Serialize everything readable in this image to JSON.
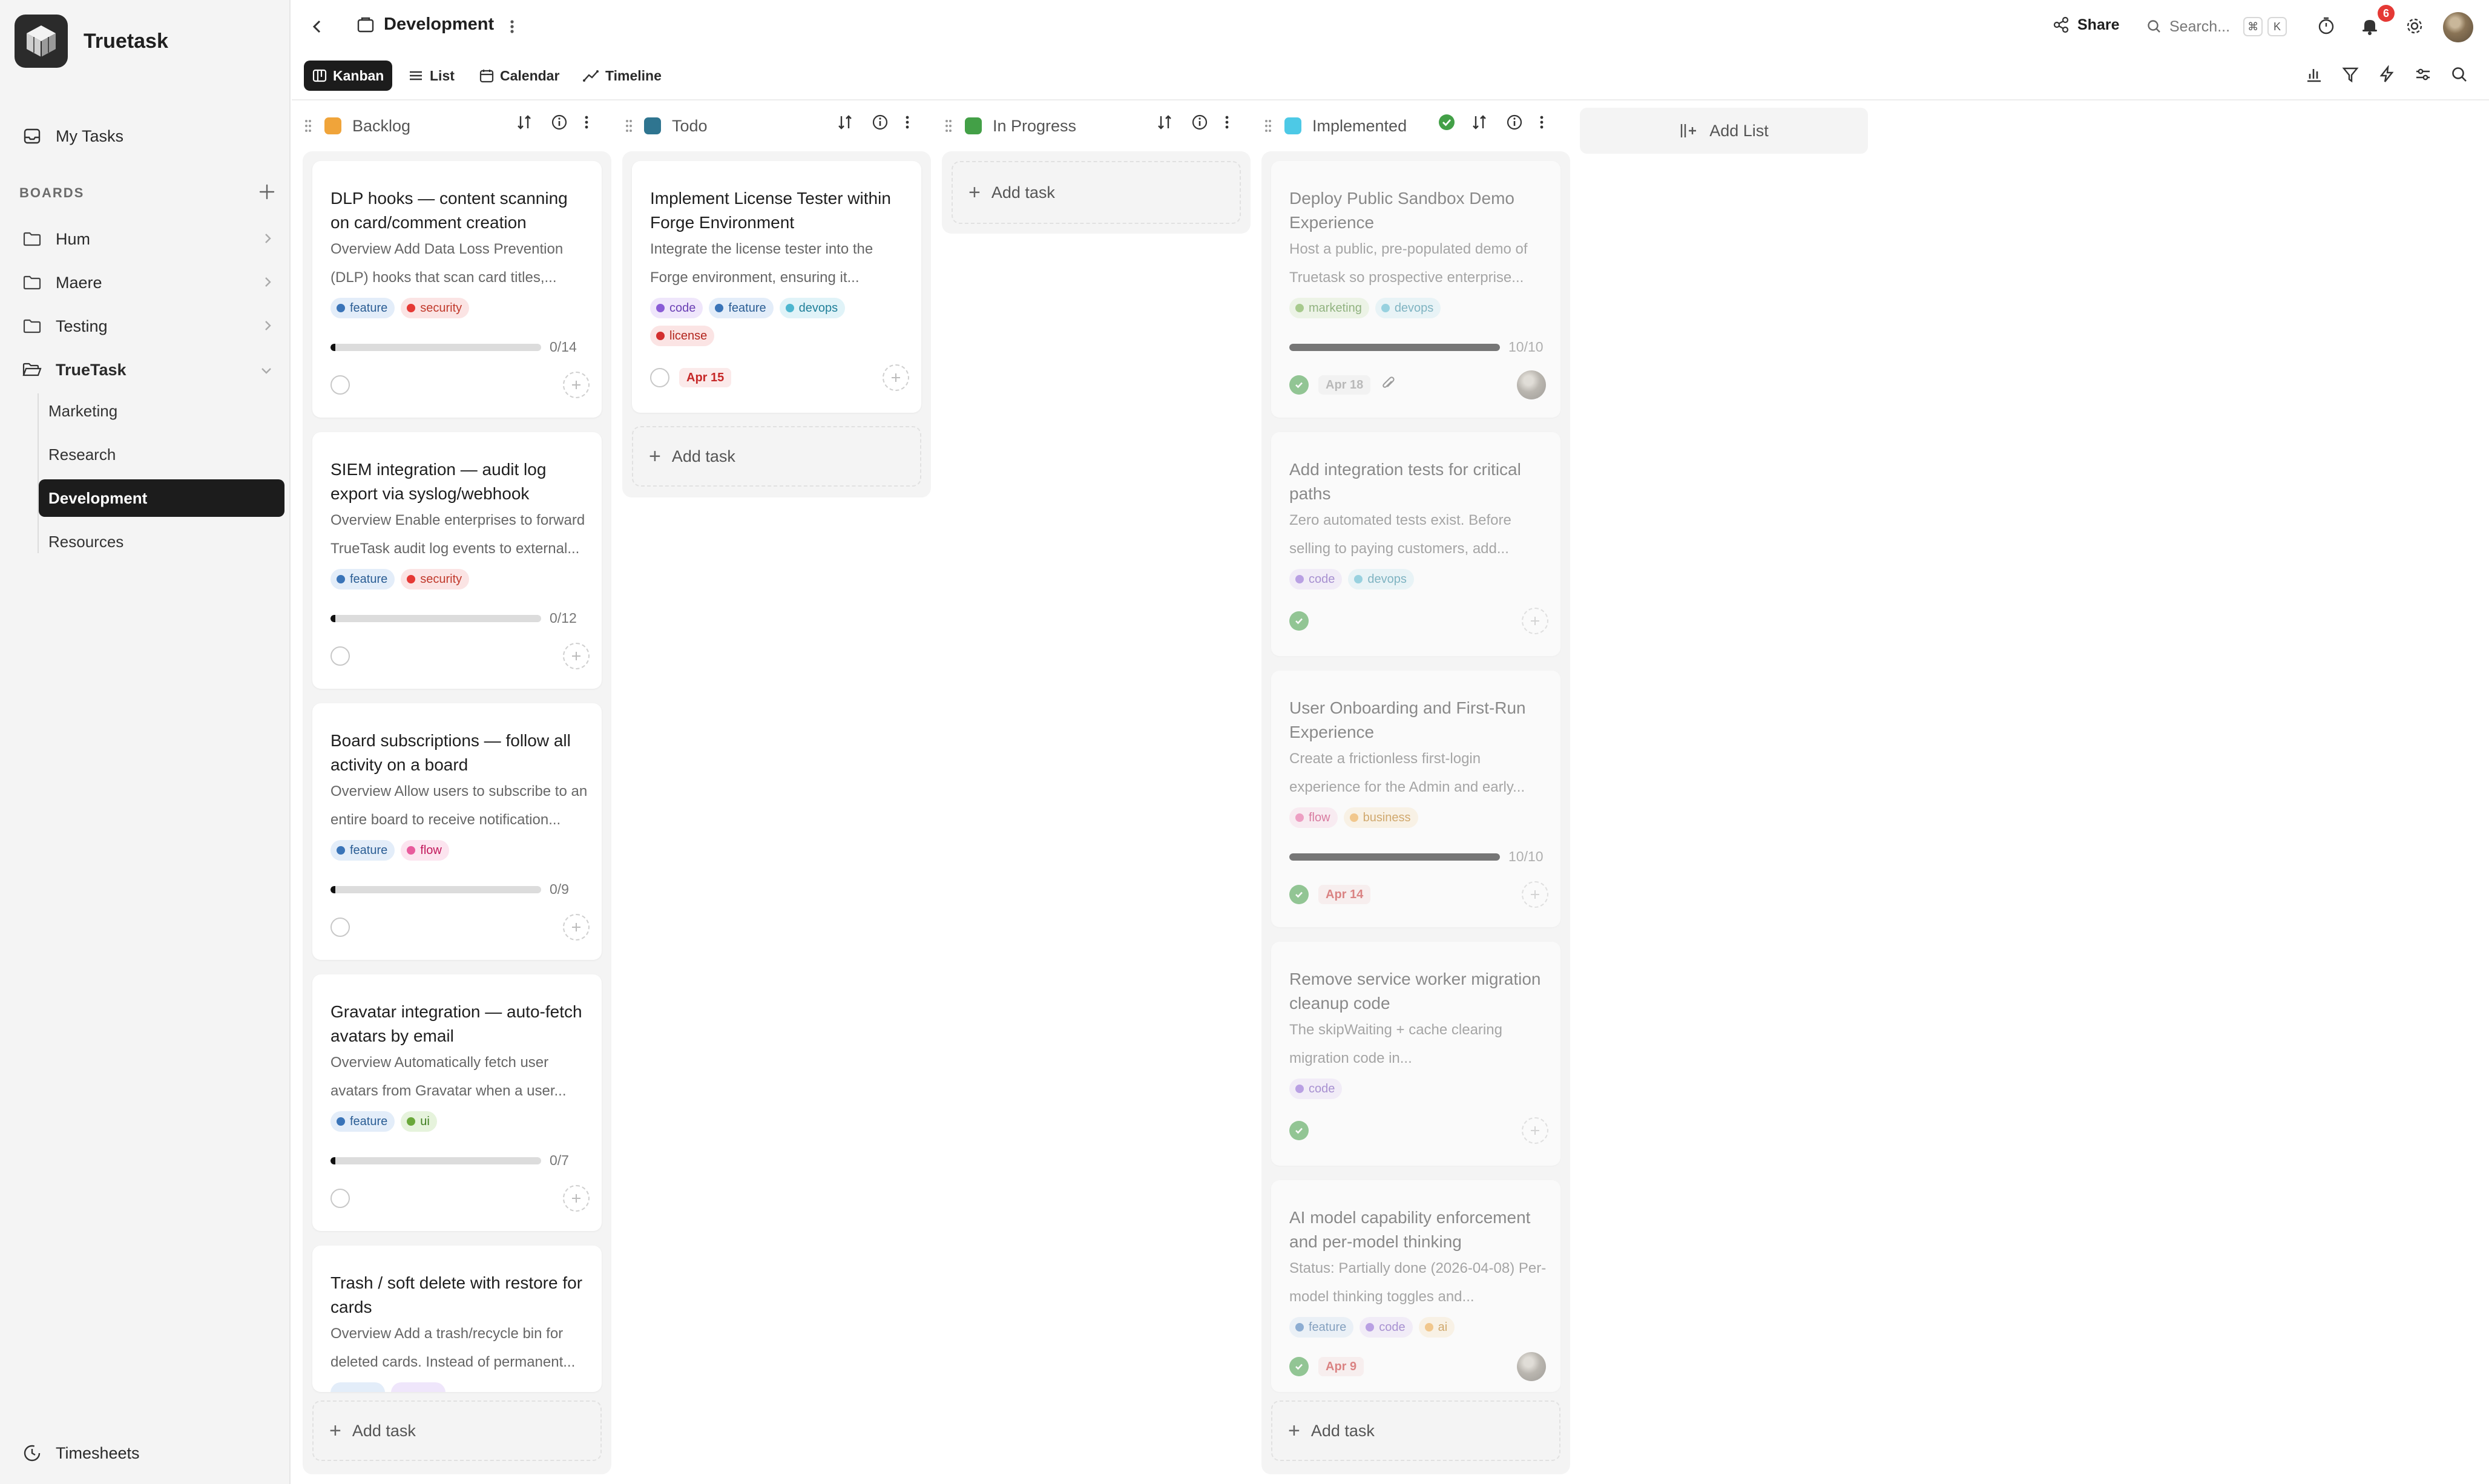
{
  "app": {
    "name": "Truetask",
    "board_title": "Development",
    "share_label": "Share",
    "search_placeholder": "Search...",
    "kbd_cmd": "⌘",
    "kbd_k": "K",
    "notification_count": "6"
  },
  "sidebar": {
    "my_tasks": "My Tasks",
    "boards_label": "BOARDS",
    "boards": [
      {
        "label": "Hum"
      },
      {
        "label": "Maere"
      },
      {
        "label": "Testing"
      },
      {
        "label": "TrueTask"
      }
    ],
    "truetask_children": [
      {
        "label": "Marketing"
      },
      {
        "label": "Research"
      },
      {
        "label": "Development"
      },
      {
        "label": "Resources"
      }
    ],
    "timesheets": "Timesheets"
  },
  "views": [
    {
      "label": "Kanban"
    },
    {
      "label": "List"
    },
    {
      "label": "Calendar"
    },
    {
      "label": "Timeline"
    }
  ],
  "colors": {
    "backlog": "#f0a43a",
    "todo": "#2f7590",
    "in_progress": "#43a047",
    "implemented": "#4dc9e6",
    "accent_dark": "#1c1c1c"
  },
  "columns": {
    "backlog": {
      "name": "Backlog",
      "cards": [
        {
          "title": "DLP hooks — content scanning on card/comment creation",
          "desc": "Overview Add Data Loss Prevention (DLP) hooks that scan card titles,...",
          "tags": [
            {
              "label": "feature"
            },
            {
              "label": "security"
            }
          ],
          "progress": {
            "done": 0,
            "total": 14,
            "text": "0/14"
          }
        },
        {
          "title": "SIEM integration — audit log export via syslog/webhook",
          "desc": "Overview Enable enterprises to forward TrueTask audit log events to external...",
          "tags": [
            {
              "label": "feature"
            },
            {
              "label": "security"
            }
          ],
          "progress": {
            "done": 0,
            "total": 12,
            "text": "0/12"
          }
        },
        {
          "title": "Board subscriptions — follow all activity on a board",
          "desc": "Overview Allow users to subscribe to an entire board to receive notification...",
          "tags": [
            {
              "label": "feature"
            },
            {
              "label": "flow"
            }
          ],
          "progress": {
            "done": 0,
            "total": 9,
            "text": "0/9"
          }
        },
        {
          "title": "Gravatar integration — auto-fetch avatars by email",
          "desc": "Overview Automatically fetch user avatars from Gravatar when a user...",
          "tags": [
            {
              "label": "feature"
            },
            {
              "label": "ui"
            }
          ],
          "progress": {
            "done": 0,
            "total": 7,
            "text": "0/7"
          }
        },
        {
          "title": "Trash / soft delete with restore for cards",
          "desc": "Overview Add a trash/recycle bin for deleted cards. Instead of permanent..."
        }
      ],
      "add_task": "Add task"
    },
    "todo": {
      "name": "Todo",
      "cards": [
        {
          "title": "Implement License Tester within Forge Environment",
          "desc": "Integrate the license tester into the Forge environment, ensuring it...",
          "tags": [
            {
              "label": "code"
            },
            {
              "label": "feature"
            },
            {
              "label": "devops"
            },
            {
              "label": "license"
            }
          ],
          "date": "Apr 15"
        }
      ],
      "add_task": "Add task"
    },
    "in_progress": {
      "name": "In Progress",
      "add_task": "Add task"
    },
    "implemented": {
      "name": "Implemented",
      "cards": [
        {
          "title": "Deploy Public Sandbox Demo Experience",
          "desc": "Host a public, pre-populated demo of Truetask so prospective enterprise...",
          "tags": [
            {
              "label": "marketing"
            },
            {
              "label": "devops"
            }
          ],
          "progress": {
            "done": 10,
            "total": 10,
            "text": "10/10"
          },
          "date": "Apr 18"
        },
        {
          "title": "Add integration tests for critical paths",
          "desc": "Zero automated tests exist. Before selling to paying customers, add...",
          "tags": [
            {
              "label": "code"
            },
            {
              "label": "devops"
            }
          ]
        },
        {
          "title": "User Onboarding and First-Run Experience",
          "desc": "Create a frictionless first-login experience for the Admin and early...",
          "tags": [
            {
              "label": "flow"
            },
            {
              "label": "business"
            }
          ],
          "progress": {
            "done": 10,
            "total": 10,
            "text": "10/10"
          },
          "date": "Apr 14"
        },
        {
          "title": "Remove service worker migration cleanup code",
          "desc": "The skipWaiting + cache clearing migration code in...",
          "tags": [
            {
              "label": "code"
            }
          ]
        },
        {
          "title": "AI model capability enforcement and per-model thinking",
          "desc": "Status: Partially done (2026-04-08) Per-model thinking toggles and...",
          "tags": [
            {
              "label": "feature"
            },
            {
              "label": "code"
            },
            {
              "label": "ai"
            }
          ],
          "date": "Apr 9"
        }
      ],
      "add_task": "Add task"
    }
  },
  "add_list": "Add List"
}
